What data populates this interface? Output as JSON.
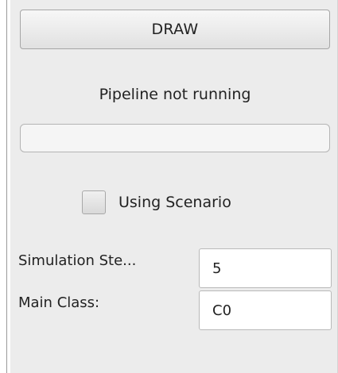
{
  "draw_button": {
    "label": "DRAW"
  },
  "status": {
    "text": "Pipeline not running"
  },
  "progress": {
    "value": 0
  },
  "scenario": {
    "label": "Using Scenario",
    "checked": false
  },
  "fields": [
    {
      "label": "Simulation Ste...",
      "value": "5"
    },
    {
      "label": "Main Class:",
      "value": "C0"
    }
  ]
}
